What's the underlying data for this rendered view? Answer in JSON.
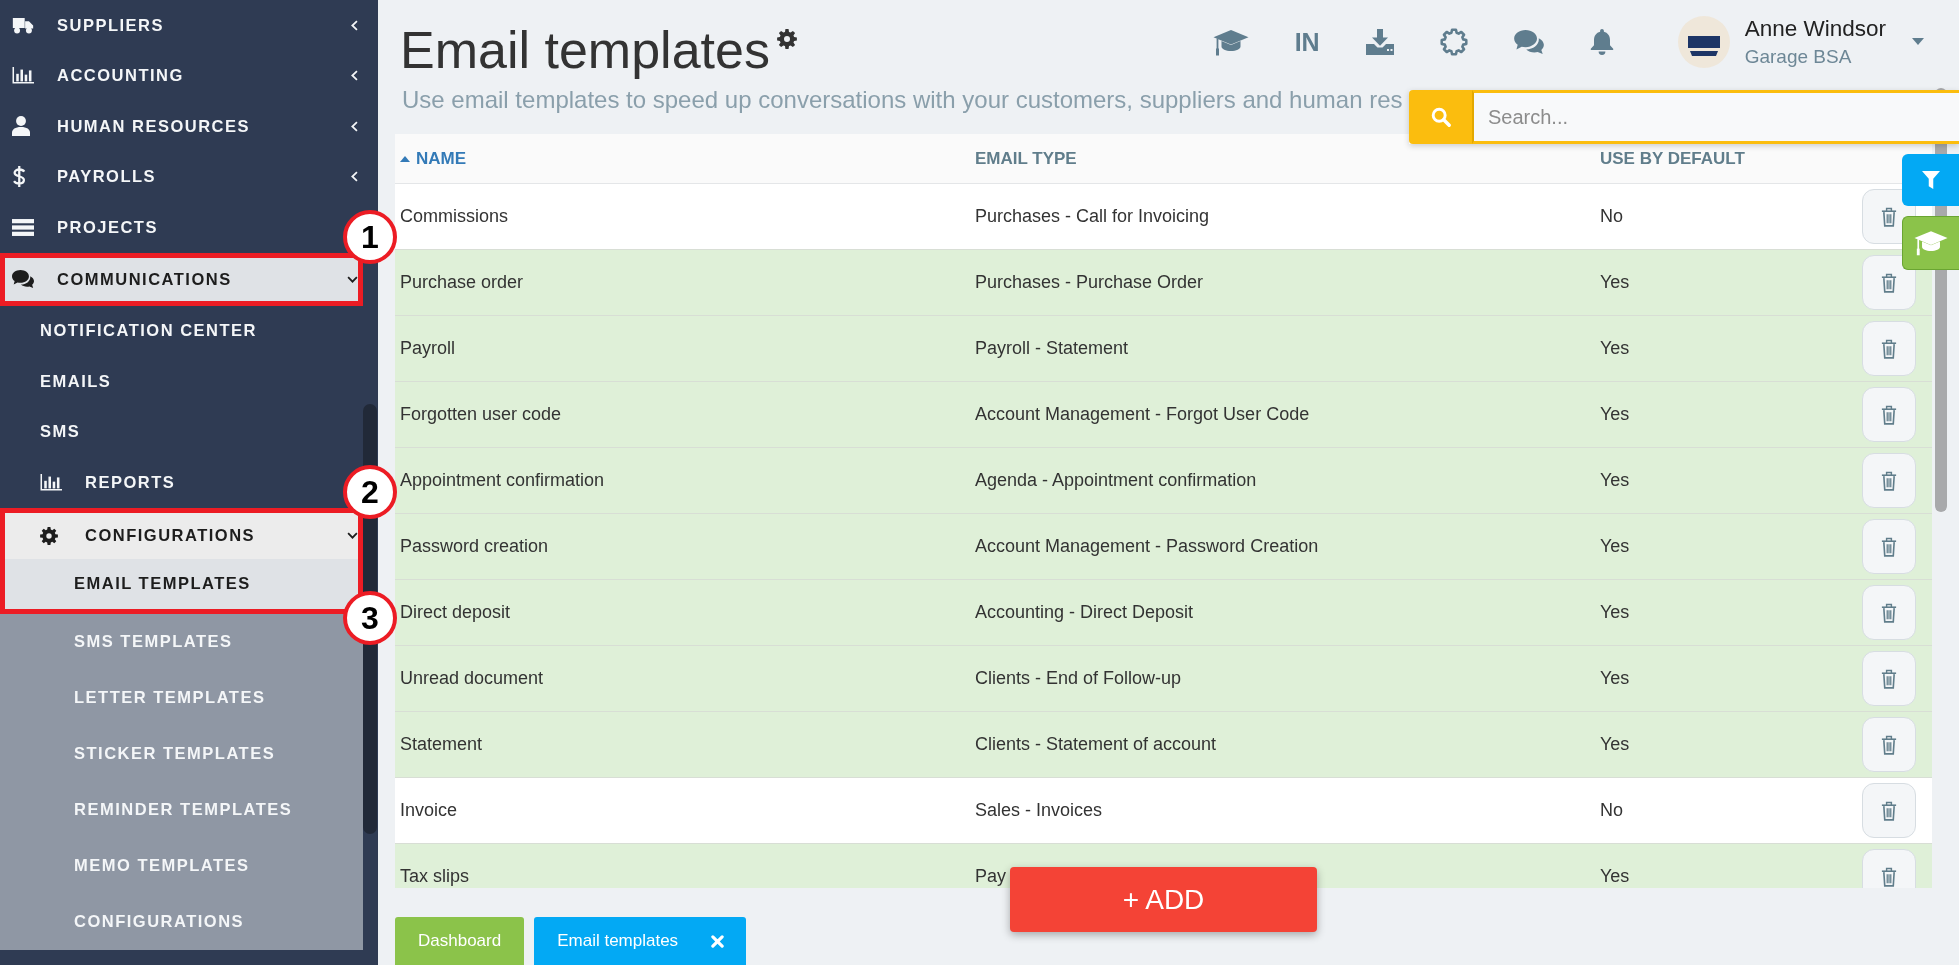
{
  "sidebar": {
    "items": [
      {
        "label": "SUPPLIERS",
        "expanded": false,
        "selected": false
      },
      {
        "label": "ACCOUNTING",
        "expanded": false,
        "selected": false
      },
      {
        "label": "HUMAN RESOURCES",
        "expanded": false,
        "selected": false
      },
      {
        "label": "PAYROLLS",
        "expanded": false,
        "selected": false
      },
      {
        "label": "PROJECTS",
        "selected": false
      },
      {
        "label": "COMMUNICATIONS",
        "expanded": true,
        "selected": true,
        "callout": "1",
        "children": [
          {
            "label": "NOTIFICATION CENTER",
            "selected": false
          },
          {
            "label": "EMAILS",
            "selected": false
          },
          {
            "label": "SMS",
            "selected": false
          },
          {
            "label": "REPORTS",
            "selected": false
          },
          {
            "label": "CONFIGURATIONS",
            "expanded": true,
            "selected": true,
            "callout": "2",
            "children": [
              {
                "label": "EMAIL TEMPLATES",
                "selected": true,
                "callout": "3"
              },
              {
                "label": "SMS TEMPLATES",
                "selected": false
              },
              {
                "label": "LETTER TEMPLATES",
                "selected": false
              },
              {
                "label": "STICKER TEMPLATES",
                "selected": false
              },
              {
                "label": "REMINDER TEMPLATES",
                "selected": false
              },
              {
                "label": "MEMO TEMPLATES",
                "selected": false
              },
              {
                "label": "CONFIGURATIONS",
                "selected": false
              }
            ]
          }
        ]
      }
    ]
  },
  "header": {
    "title": "Email templates",
    "subtitle": "Use email templates to speed up conversations with your customers, suppliers and human res",
    "language": "IN",
    "user": {
      "name": "Anne Windsor",
      "company": "Garage BSA"
    }
  },
  "search": {
    "placeholder": "Search..."
  },
  "table": {
    "columns": [
      {
        "label": "NAME",
        "sorted": true
      },
      {
        "label": "EMAIL TYPE",
        "sorted": false
      },
      {
        "label": "USE BY DEFAULT",
        "sorted": false
      }
    ],
    "rows": [
      {
        "cells": [
          "Commissions",
          "Purchases - Call for Invoicing",
          "No"
        ],
        "default": false
      },
      {
        "cells": [
          "Purchase order",
          "Purchases - Purchase Order",
          "Yes"
        ],
        "default": true
      },
      {
        "cells": [
          "Payroll",
          "Payroll - Statement",
          "Yes"
        ],
        "default": true
      },
      {
        "cells": [
          "Forgotten user code",
          "Account Management - Forgot User Code",
          "Yes"
        ],
        "default": true
      },
      {
        "cells": [
          "Appointment confirmation",
          "Agenda - Appointment confirmation",
          "Yes"
        ],
        "default": true
      },
      {
        "cells": [
          "Password creation",
          "Account Management - Password Creation",
          "Yes"
        ],
        "default": true
      },
      {
        "cells": [
          "Direct deposit",
          "Accounting - Direct Deposit",
          "Yes"
        ],
        "default": true
      },
      {
        "cells": [
          "Unread document",
          "Clients - End of Follow-up",
          "Yes"
        ],
        "default": true
      },
      {
        "cells": [
          "Statement",
          "Clients - Statement of account",
          "Yes"
        ],
        "default": true
      },
      {
        "cells": [
          "Invoice",
          "Sales - Invoices",
          "No"
        ],
        "default": false
      },
      {
        "cells": [
          "Tax slips",
          "Pay",
          "Yes"
        ],
        "default": true
      }
    ]
  },
  "add_button": {
    "label": "+ ADD"
  },
  "tabs": [
    {
      "label": "Dashboard",
      "selected": false,
      "closable": false
    },
    {
      "label": "Email templates",
      "selected": true,
      "closable": true
    }
  ]
}
